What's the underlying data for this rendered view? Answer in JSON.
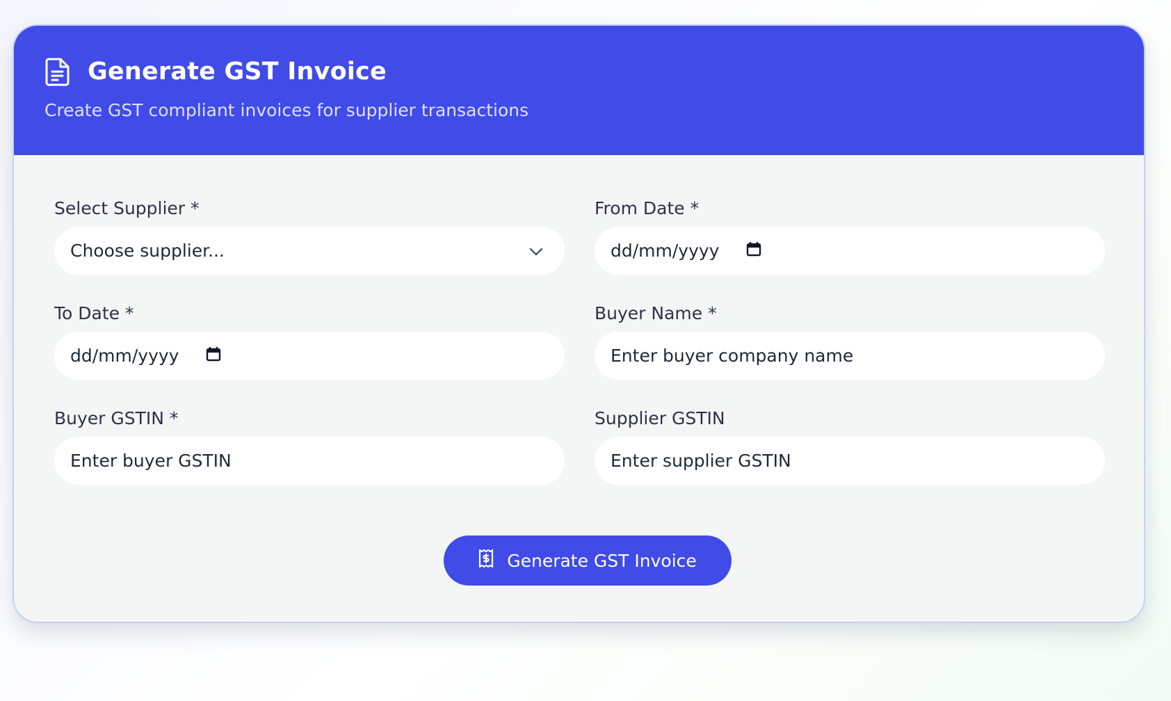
{
  "header": {
    "title": "Generate GST Invoice",
    "subtitle": "Create GST compliant invoices for supplier transactions",
    "icon": "document-icon",
    "color": "#404be8"
  },
  "form": {
    "supplier": {
      "label": "Select Supplier *",
      "value": "Choose supplier..."
    },
    "from_date": {
      "label": "From Date *",
      "value": "dd/mm/yyyy"
    },
    "to_date": {
      "label": "To Date *",
      "value": "dd/mm/yyyy"
    },
    "buyer_name": {
      "label": "Buyer Name *",
      "placeholder": "Enter buyer company name"
    },
    "buyer_gstin": {
      "label": "Buyer GSTIN *",
      "placeholder": "Enter buyer GSTIN"
    },
    "supplier_gstin": {
      "label": "Supplier GSTIN",
      "placeholder": "Enter supplier GSTIN"
    }
  },
  "submit": {
    "label": "Generate GST Invoice",
    "icon": "receipt-icon"
  }
}
